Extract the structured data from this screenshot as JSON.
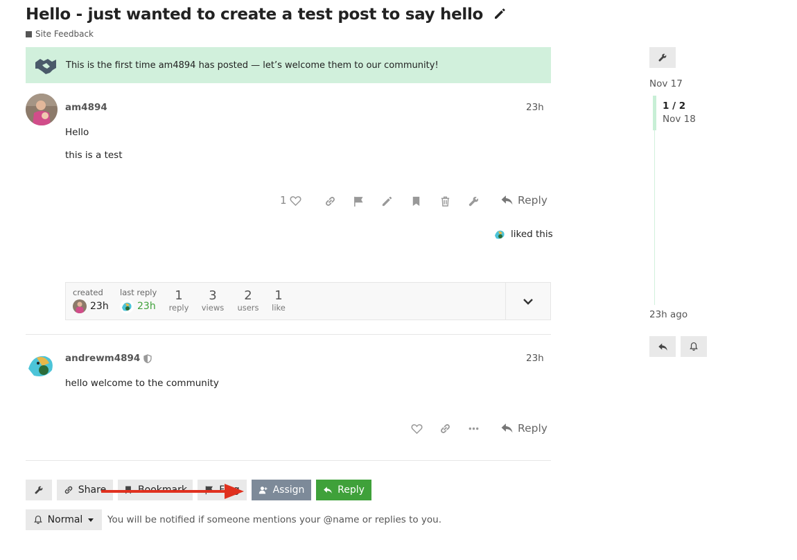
{
  "topic": {
    "title": "Hello - just wanted to create a test post to say hello",
    "category": "Site Feedback"
  },
  "welcome_notice": "This is the first time am4894 has posted — let’s welcome them to our community!",
  "posts": [
    {
      "username": "am4894",
      "time": "23h",
      "lines": [
        "Hello",
        "this is a test"
      ],
      "like_count": "1",
      "reply_label": "Reply",
      "liked_text": "liked this"
    },
    {
      "username": "andrewm4894",
      "time": "23h",
      "lines": [
        "hello welcome to the community"
      ],
      "reply_label": "Reply"
    }
  ],
  "topic_map": {
    "created_label": "created",
    "created_time": "23h",
    "last_reply_label": "last reply",
    "last_reply_time": "23h",
    "stats": [
      {
        "value": "1",
        "label": "reply"
      },
      {
        "value": "3",
        "label": "views"
      },
      {
        "value": "2",
        "label": "users"
      },
      {
        "value": "1",
        "label": "like"
      }
    ]
  },
  "footer": {
    "share": "Share",
    "bookmark": "Bookmark",
    "flag": "Flag",
    "assign": "Assign",
    "reply": "Reply",
    "notification_level": "Normal",
    "notification_text": "You will be notified if someone mentions your @name or replies to you."
  },
  "timeline": {
    "start_date": "Nov 17",
    "position": "1 / 2",
    "position_date": "Nov 18",
    "end_label": "23h ago"
  },
  "colors": {
    "accent_green": "#3fa13a",
    "welcome_bg": "#d1f0dc",
    "assign_bg": "#7d8a99",
    "annotation_arrow": "#e0311f"
  }
}
